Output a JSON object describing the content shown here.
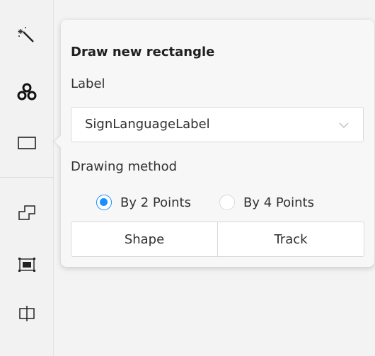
{
  "toolbar": {
    "tools": [
      {
        "icon": "magic-wand-icon"
      },
      {
        "icon": "cursor-tracking-icon"
      },
      {
        "icon": "rectangle-icon"
      },
      {
        "icon": "polygon-icon"
      },
      {
        "icon": "image-crop-icon"
      },
      {
        "icon": "split-icon"
      }
    ]
  },
  "popover": {
    "title": "Draw new rectangle",
    "label_heading": "Label",
    "label_select": {
      "value": "SignLanguageLabel"
    },
    "method_heading": "Drawing method",
    "methods": [
      {
        "label": "By 2 Points",
        "checked": true
      },
      {
        "label": "By 4 Points",
        "checked": false
      }
    ],
    "buttons": {
      "shape": "Shape",
      "track": "Track"
    }
  },
  "colors": {
    "accent": "#1890ff",
    "border": "#d9d9d9",
    "text": "#303030"
  }
}
